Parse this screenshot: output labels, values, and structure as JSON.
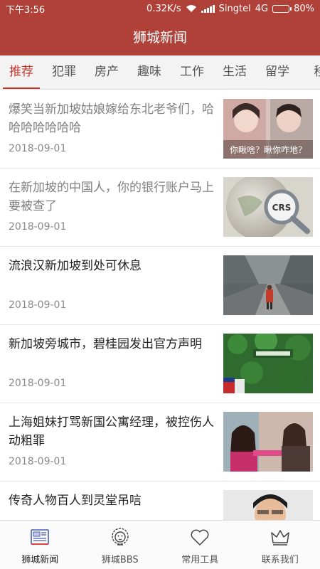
{
  "status_bar": {
    "time": "下午3:56",
    "speed": "0.32K/s",
    "carrier": "Singtel",
    "network": "4G",
    "battery": "80%",
    "battery_level": 0.8
  },
  "header": {
    "title": "狮城新闻"
  },
  "tabs": [
    {
      "label": "推荐",
      "active": true
    },
    {
      "label": "犯罪"
    },
    {
      "label": "房产"
    },
    {
      "label": "趣味"
    },
    {
      "label": "工作"
    },
    {
      "label": "生活"
    },
    {
      "label": "留学"
    },
    {
      "label": "移"
    }
  ],
  "news": [
    {
      "title": "爆笑当新加坡姑娘嫁给东北老爷们，哈哈哈哈哈哈哈",
      "date": "2018-09-01",
      "read": true,
      "image_caption": "你瞅啥？瞅你咋地？",
      "image_icon": "couple-photo-icon"
    },
    {
      "title": "在新加坡的中国人，你的银行账户马上要被查了",
      "date": "2018-09-01",
      "read": true,
      "image_caption": "CRS",
      "image_icon": "magnifier-globe-icon"
    },
    {
      "title": "流浪汉新加坡到处可休息",
      "date": "2018-09-01",
      "read": false,
      "image_icon": "traveler-road-icon"
    },
    {
      "title": "新加坡旁城市，碧桂园发出官方声明",
      "date": "2018-09-01",
      "read": false,
      "image_icon": "green-wall-icon"
    },
    {
      "title": "上海姐妹打骂新国公寓经理，被控伤人动粗罪",
      "date": "2018-09-01",
      "read": false,
      "image_icon": "women-photo-icon"
    },
    {
      "title": "传奇人物百人到灵堂吊唁",
      "date": "",
      "read": false,
      "image_icon": "man-portrait-icon"
    }
  ],
  "bottom_nav": [
    {
      "label": "狮城新闻",
      "icon": "news-icon",
      "active": true
    },
    {
      "label": "狮城BBS",
      "icon": "lion-icon"
    },
    {
      "label": "常用工具",
      "icon": "heart-icon"
    },
    {
      "label": "联系我们",
      "icon": "crown-icon"
    }
  ],
  "colors": {
    "brand": "#b04139",
    "accent": "#c5362d"
  }
}
